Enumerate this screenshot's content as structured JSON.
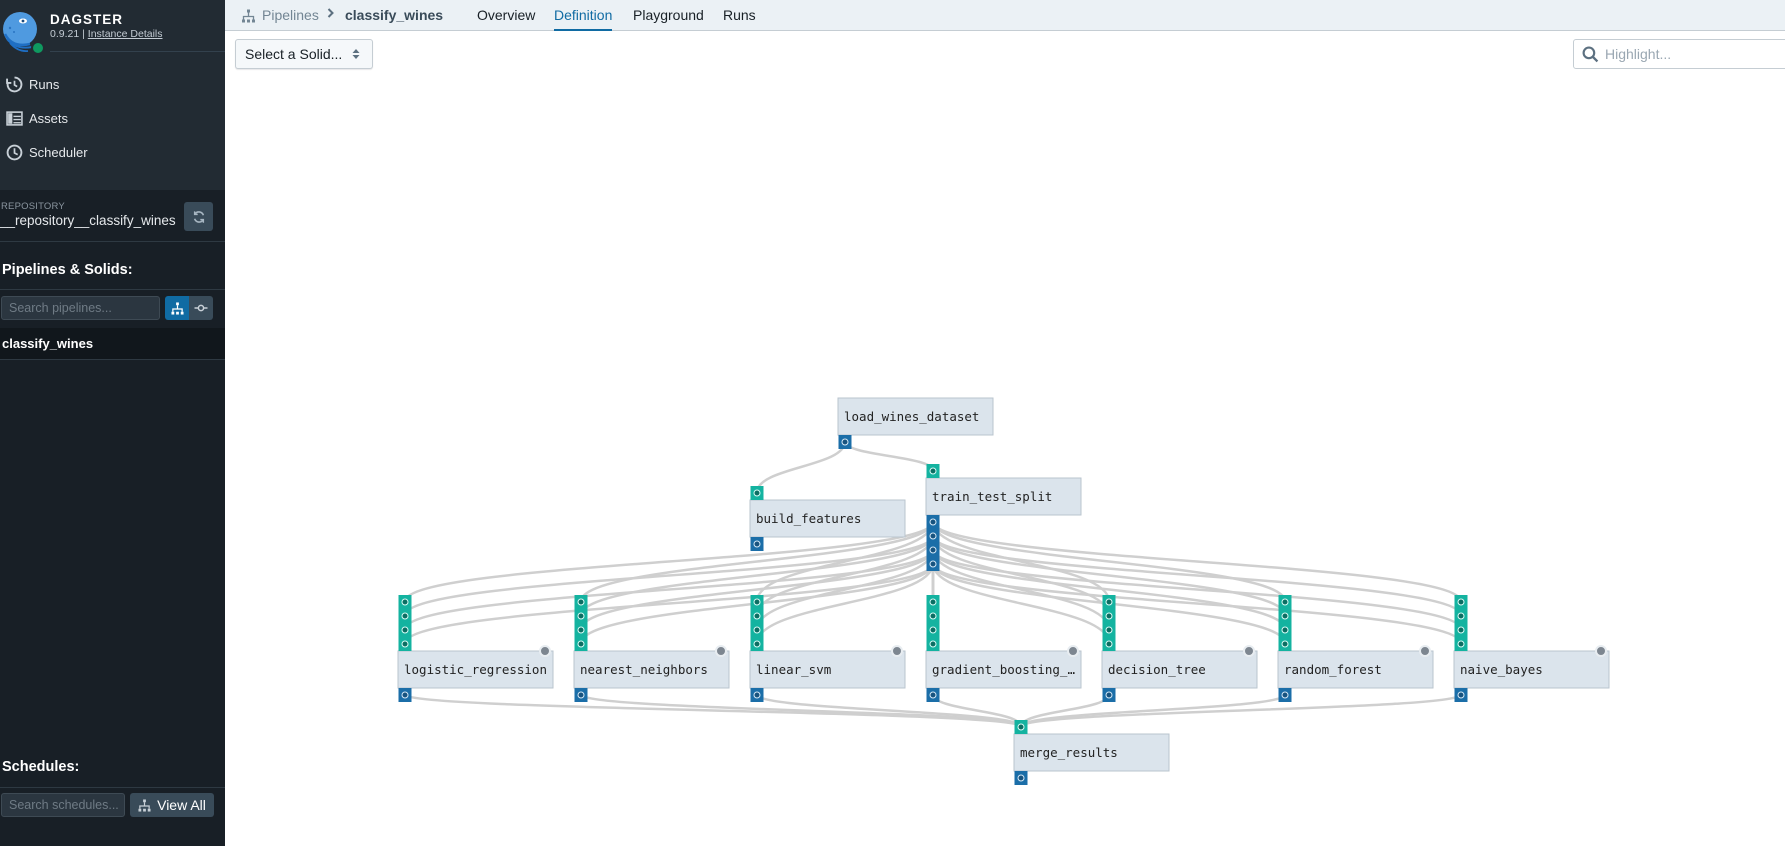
{
  "app": {
    "brand": "DAGSTER",
    "version": "0.9.21",
    "version_sep": "|",
    "instance_link": "Instance Details",
    "status_color": "#0f9960"
  },
  "sidebar": {
    "nav": [
      {
        "label": "Runs",
        "icon": "history-icon"
      },
      {
        "label": "Assets",
        "icon": "table-icon"
      },
      {
        "label": "Scheduler",
        "icon": "clock-icon"
      }
    ],
    "repository": {
      "label": "REPOSITORY",
      "name": "__repository__classify_wines"
    },
    "pipelines_section": {
      "title": "Pipelines & Solids:",
      "search_placeholder": "Search pipelines...",
      "items": [
        {
          "name": "classify_wines",
          "selected": true
        }
      ]
    },
    "schedules_section": {
      "title": "Schedules:",
      "search_placeholder": "Search schedules...",
      "view_all_label": "View All"
    }
  },
  "topbar": {
    "breadcrumb": {
      "root": "Pipelines",
      "current": "classify_wines"
    },
    "tabs": [
      {
        "label": "Overview",
        "active": false
      },
      {
        "label": "Definition",
        "active": true
      },
      {
        "label": "Playground",
        "active": false
      },
      {
        "label": "Runs",
        "active": false
      }
    ]
  },
  "toolbar": {
    "solid_select_label": "Select a Solid...",
    "highlight_placeholder": "Highlight..."
  },
  "graph": {
    "colors": {
      "node_fill": "#dbe4ec",
      "node_border": "#b9c4ce",
      "input_port": "#14b3a0",
      "output_port": "#1b6ea8",
      "edge": "#cfcfcf",
      "config_dot": "#7d8690"
    },
    "solids": [
      {
        "id": "load_wines_dataset",
        "label": "load_wines_dataset",
        "inputs": 0,
        "outputs": 1,
        "config": false
      },
      {
        "id": "build_features",
        "label": "build_features",
        "inputs": 1,
        "outputs": 1,
        "config": false
      },
      {
        "id": "train_test_split",
        "label": "train_test_split",
        "inputs": 1,
        "outputs": 4,
        "config": false
      },
      {
        "id": "logistic_regression",
        "label": "logistic_regression",
        "inputs": 4,
        "outputs": 1,
        "config": true
      },
      {
        "id": "nearest_neighbors",
        "label": "nearest_neighbors",
        "inputs": 4,
        "outputs": 1,
        "config": true
      },
      {
        "id": "linear_svm",
        "label": "linear_svm",
        "inputs": 4,
        "outputs": 1,
        "config": true
      },
      {
        "id": "gradient_boosting",
        "label": "gradient_boosting_…",
        "inputs": 4,
        "outputs": 1,
        "config": true
      },
      {
        "id": "decision_tree",
        "label": "decision_tree",
        "inputs": 4,
        "outputs": 1,
        "config": true
      },
      {
        "id": "random_forest",
        "label": "random_forest",
        "inputs": 4,
        "outputs": 1,
        "config": true
      },
      {
        "id": "naive_bayes",
        "label": "naive_bayes",
        "inputs": 4,
        "outputs": 1,
        "config": true
      },
      {
        "id": "merge_results",
        "label": "merge_results",
        "inputs": 1,
        "outputs": 1,
        "config": false
      }
    ],
    "edges": [
      [
        "load_wines_dataset",
        0,
        "build_features",
        0
      ],
      [
        "load_wines_dataset",
        0,
        "train_test_split",
        0
      ],
      [
        "train_test_split",
        0,
        "logistic_regression",
        0
      ],
      [
        "train_test_split",
        1,
        "logistic_regression",
        1
      ],
      [
        "train_test_split",
        2,
        "logistic_regression",
        2
      ],
      [
        "train_test_split",
        3,
        "logistic_regression",
        3
      ],
      [
        "train_test_split",
        0,
        "nearest_neighbors",
        0
      ],
      [
        "train_test_split",
        1,
        "nearest_neighbors",
        1
      ],
      [
        "train_test_split",
        2,
        "nearest_neighbors",
        2
      ],
      [
        "train_test_split",
        3,
        "nearest_neighbors",
        3
      ],
      [
        "train_test_split",
        0,
        "linear_svm",
        0
      ],
      [
        "train_test_split",
        1,
        "linear_svm",
        1
      ],
      [
        "train_test_split",
        2,
        "linear_svm",
        2
      ],
      [
        "train_test_split",
        3,
        "linear_svm",
        3
      ],
      [
        "train_test_split",
        0,
        "gradient_boosting",
        0
      ],
      [
        "train_test_split",
        1,
        "gradient_boosting",
        1
      ],
      [
        "train_test_split",
        2,
        "gradient_boosting",
        2
      ],
      [
        "train_test_split",
        3,
        "gradient_boosting",
        3
      ],
      [
        "train_test_split",
        0,
        "decision_tree",
        0
      ],
      [
        "train_test_split",
        1,
        "decision_tree",
        1
      ],
      [
        "train_test_split",
        2,
        "decision_tree",
        2
      ],
      [
        "train_test_split",
        3,
        "decision_tree",
        3
      ],
      [
        "train_test_split",
        0,
        "random_forest",
        0
      ],
      [
        "train_test_split",
        1,
        "random_forest",
        1
      ],
      [
        "train_test_split",
        2,
        "random_forest",
        2
      ],
      [
        "train_test_split",
        3,
        "random_forest",
        3
      ],
      [
        "train_test_split",
        0,
        "naive_bayes",
        0
      ],
      [
        "train_test_split",
        1,
        "naive_bayes",
        1
      ],
      [
        "train_test_split",
        2,
        "naive_bayes",
        2
      ],
      [
        "train_test_split",
        3,
        "naive_bayes",
        3
      ],
      [
        "logistic_regression",
        0,
        "merge_results",
        0
      ],
      [
        "nearest_neighbors",
        0,
        "merge_results",
        0
      ],
      [
        "linear_svm",
        0,
        "merge_results",
        0
      ],
      [
        "gradient_boosting",
        0,
        "merge_results",
        0
      ],
      [
        "decision_tree",
        0,
        "merge_results",
        0
      ],
      [
        "random_forest",
        0,
        "merge_results",
        0
      ],
      [
        "naive_bayes",
        0,
        "merge_results",
        0
      ]
    ]
  }
}
